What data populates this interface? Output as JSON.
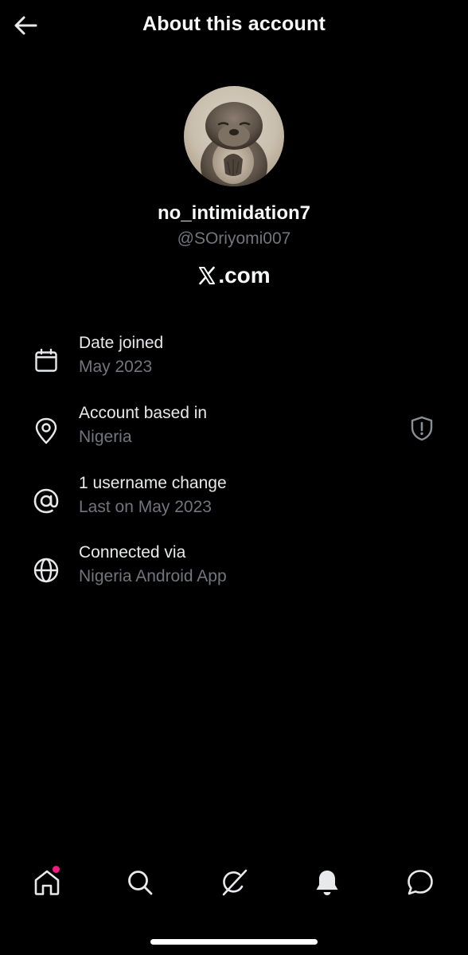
{
  "header": {
    "title": "About this account",
    "back_icon": "arrow-left-icon"
  },
  "profile": {
    "display_name": "no_intimidation7",
    "handle": "@SOriyomi007",
    "verified_via": ".com",
    "verified_via_icon": "x-logo-icon"
  },
  "info_rows": [
    {
      "icon": "calendar-icon",
      "title": "Date joined",
      "subtitle": "May 2023"
    },
    {
      "icon": "location-pin-icon",
      "title": "Account based in",
      "subtitle": "Nigeria",
      "badge_icon": "shield-icon"
    },
    {
      "icon": "at-sign-icon",
      "title": "1 username change",
      "subtitle": "Last on May 2023"
    },
    {
      "icon": "globe-icon",
      "title": "Connected via",
      "subtitle": "Nigeria Android App"
    }
  ],
  "bottom_nav": [
    {
      "icon": "home-icon",
      "has_dot": true
    },
    {
      "icon": "search-icon"
    },
    {
      "icon": "grok-icon"
    },
    {
      "icon": "bell-icon"
    },
    {
      "icon": "messages-icon"
    }
  ],
  "colors": {
    "background": "#000000",
    "primary_text": "#e7e9ea",
    "secondary_text": "#71767b",
    "notification_dot": "#f91880"
  }
}
